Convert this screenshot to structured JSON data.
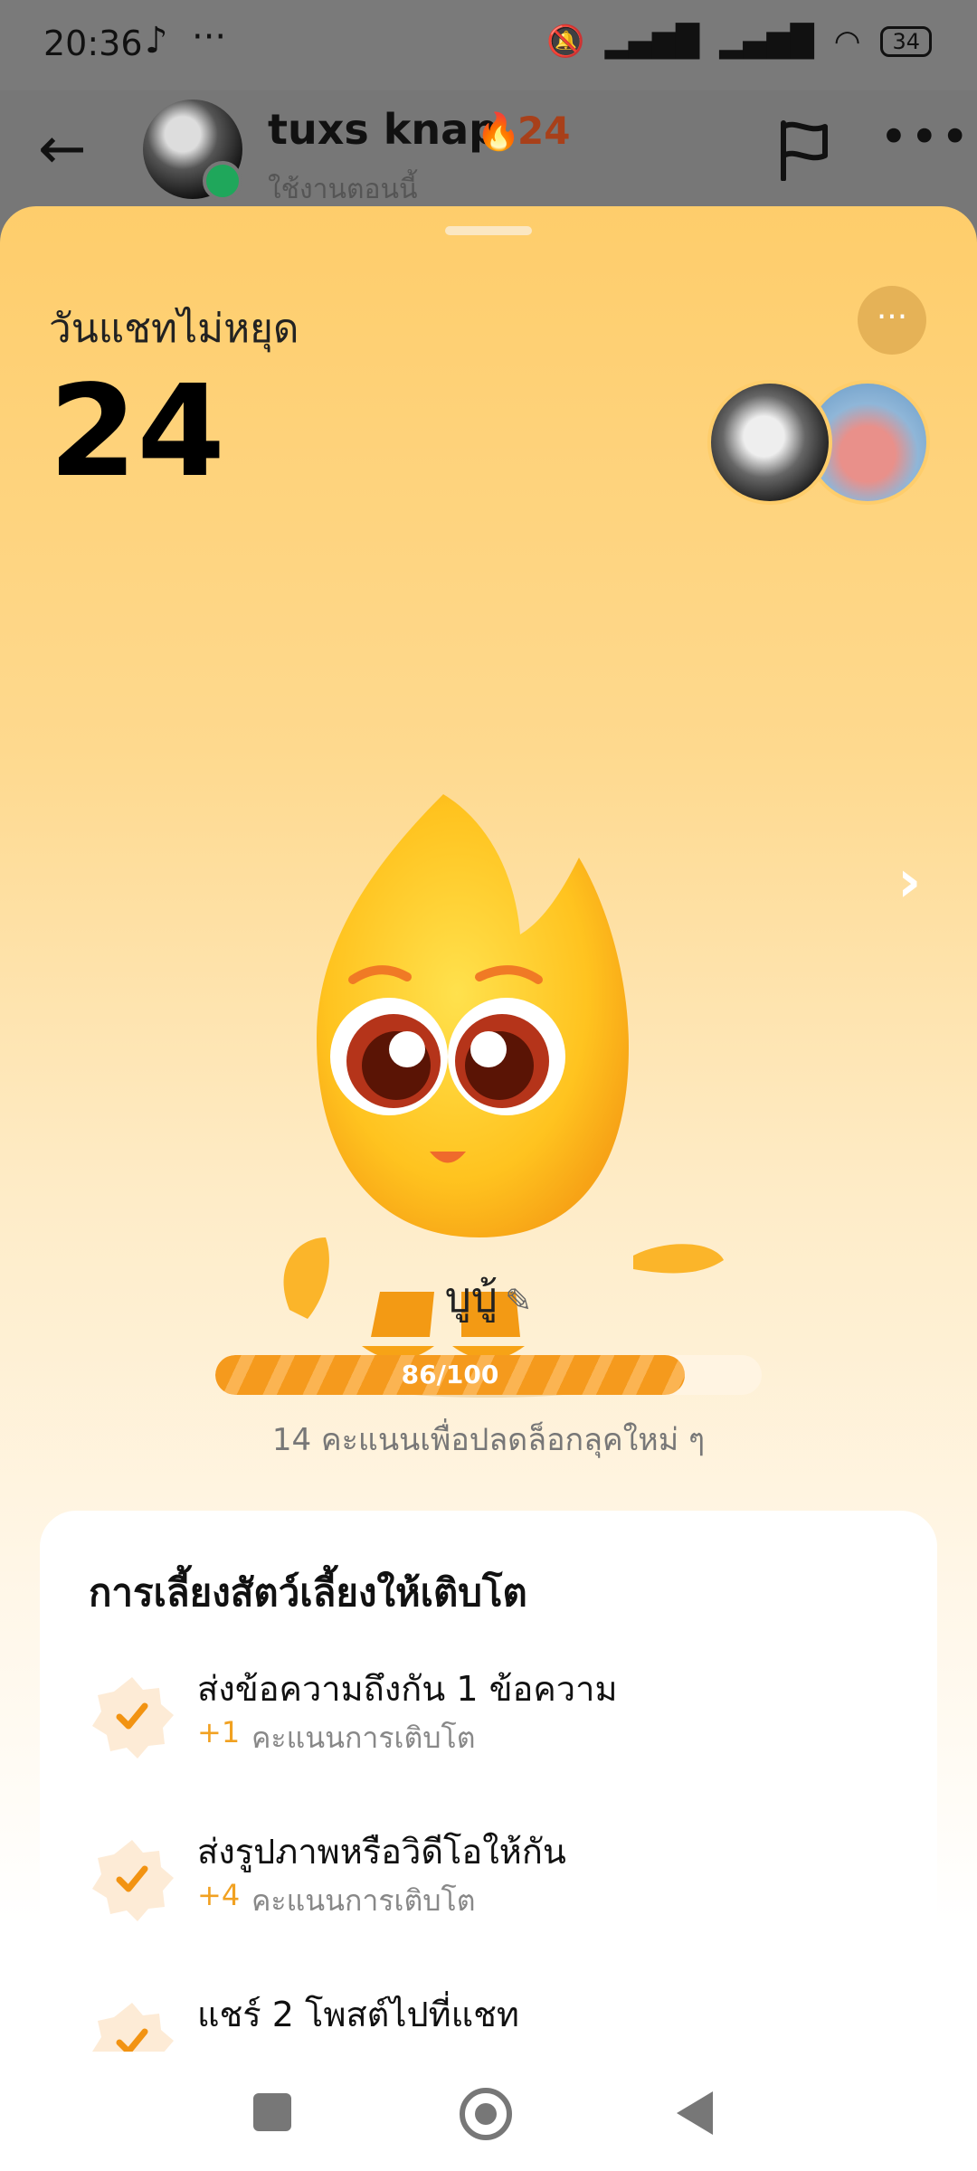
{
  "status_bar": {
    "time": "20:36",
    "app_icon": "tiktok-icon",
    "more": "···",
    "battery": "34"
  },
  "header": {
    "username": "tuxs knap",
    "streak": "24",
    "status": "ใช้งานตอนนี้"
  },
  "streak_panel": {
    "title": "วันแชทไม่หยุด",
    "count": "24",
    "more": "···",
    "next": "›"
  },
  "pet": {
    "name": "บูบู้",
    "progress_text": "86/100",
    "progress_fraction": 0.86,
    "hint": "14 คะแนนเพื่อปลดล็อกลุคใหม่ ๆ"
  },
  "growth_card": {
    "title": "การเลี้ยงสัตว์เลี้ยงให้เติบโต",
    "points_label": "คะแนนการเติบโต",
    "tasks": [
      {
        "label": "ส่งข้อความถึงกัน 1 ข้อความ",
        "points": "+1"
      },
      {
        "label": "ส่งรูปภาพหรือวิดีโอให้กัน",
        "points": "+4"
      },
      {
        "label": "แชร์ 2 โพสต์ไปที่แชท",
        "points": ""
      }
    ]
  },
  "colors": {
    "accent": "#f59a1d",
    "sheet_top": "#fecd6b",
    "online": "#1fa75b"
  }
}
